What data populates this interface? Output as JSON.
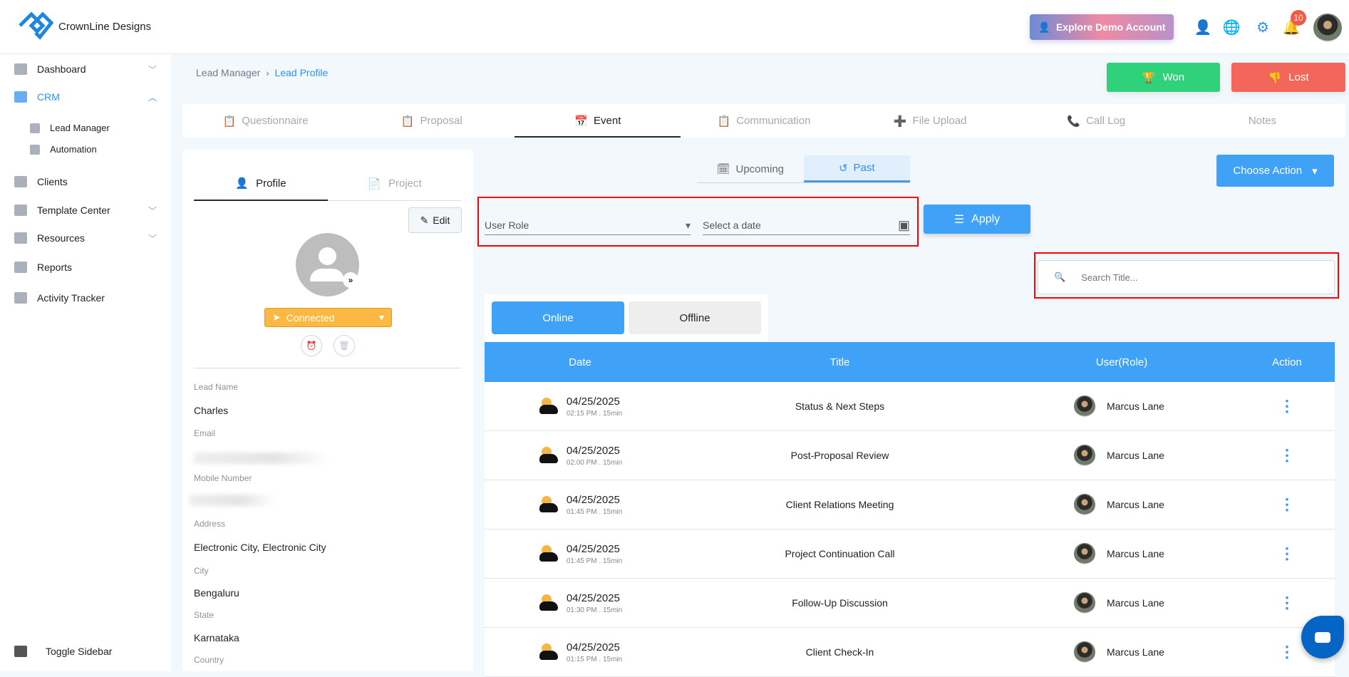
{
  "brand": {
    "name": "CrownLine Designs"
  },
  "header": {
    "demo_label": "Explore Demo Account",
    "notification_count": "10"
  },
  "sidebar": {
    "items": [
      {
        "label": "Dashboard"
      },
      {
        "label": "CRM"
      },
      {
        "label": "Lead Manager"
      },
      {
        "label": "Automation"
      },
      {
        "label": "Clients"
      },
      {
        "label": "Template Center"
      },
      {
        "label": "Resources"
      },
      {
        "label": "Reports"
      },
      {
        "label": "Activity Tracker"
      }
    ],
    "toggle_label": "Toggle Sidebar"
  },
  "breadcrumb": {
    "parent": "Lead Manager",
    "current": "Lead Profile"
  },
  "actions": {
    "won": "Won",
    "lost": "Lost",
    "choose_action": "Choose Action",
    "apply": "Apply"
  },
  "tabs": [
    "Questionnaire",
    "Proposal",
    "Event",
    "Communication",
    "File Upload",
    "Call Log",
    "Notes"
  ],
  "profile": {
    "tab_profile": "Profile",
    "tab_project": "Project",
    "edit": "Edit",
    "status": "Connected",
    "fields": [
      {
        "label": "Lead Name",
        "value": "Charles"
      },
      {
        "label": "Email",
        "value": ""
      },
      {
        "label": "Mobile Number",
        "value": ""
      },
      {
        "label": "Address",
        "value": "Electronic City, Electronic City"
      },
      {
        "label": "City",
        "value": "Bengaluru"
      },
      {
        "label": "State",
        "value": "Karnataka"
      },
      {
        "label": "Country",
        "value": ""
      }
    ]
  },
  "events": {
    "tab_upcoming": "Upcoming",
    "tab_past": "Past",
    "user_role_placeholder": "User Role",
    "date_placeholder": "Select a date",
    "search_placeholder": "Search Title...",
    "online": "Online",
    "offline": "Offline",
    "columns": [
      "Date",
      "Title",
      "User(Role)",
      "Action"
    ],
    "rows": [
      {
        "date": "04/25/2025",
        "time": "02:15 PM . 15min",
        "title": "Status & Next Steps",
        "user": "Marcus Lane"
      },
      {
        "date": "04/25/2025",
        "time": "02:00 PM . 15min",
        "title": "Post-Proposal Review",
        "user": "Marcus Lane"
      },
      {
        "date": "04/25/2025",
        "time": "01:45 PM . 15min",
        "title": "Client Relations Meeting",
        "user": "Marcus Lane"
      },
      {
        "date": "04/25/2025",
        "time": "01:45 PM . 15min",
        "title": "Project Continuation Call",
        "user": "Marcus Lane"
      },
      {
        "date": "04/25/2025",
        "time": "01:30 PM . 15min",
        "title": "Follow-Up Discussion",
        "user": "Marcus Lane"
      },
      {
        "date": "04/25/2025",
        "time": "01:15 PM . 15min",
        "title": "Client Check-In",
        "user": "Marcus Lane"
      }
    ]
  },
  "colors": {
    "primary": "#3fa2f7",
    "won": "#2fd27a",
    "lost": "#f3675b",
    "status": "#fbb944"
  }
}
